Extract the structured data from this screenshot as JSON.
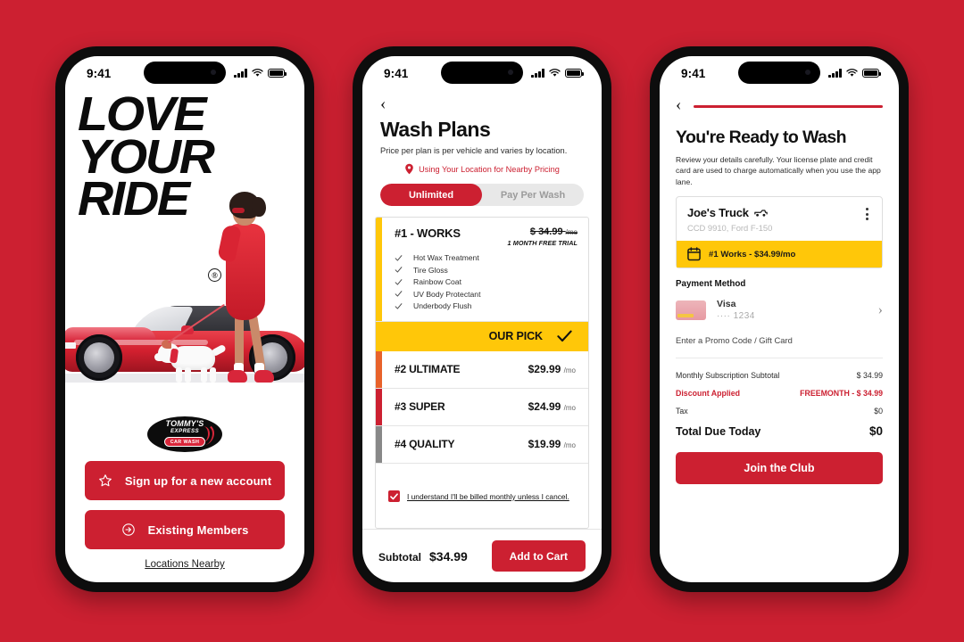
{
  "background_color": "#CC2031",
  "brand": {
    "primary_red": "#CC2031",
    "accent_yellow": "#FFC709",
    "logo_line1": "TOMMY'S",
    "logo_line2": "EXPRESS",
    "logo_pill": "CAR WASH"
  },
  "status_bar": {
    "time": "9:41",
    "signal_icon": "cellular-bars-icon",
    "wifi_icon": "wifi-icon",
    "battery_icon": "battery-icon"
  },
  "phone1": {
    "hero": {
      "line1": "LOVE",
      "line2": "YOUR",
      "line3": "RIDE",
      "registered_mark": "®",
      "image_alt": "red-convertible-with-woman-and-dog"
    },
    "signup_button": "Sign up for a new account",
    "signup_icon": "star-icon",
    "members_button": "Existing Members",
    "members_icon": "login-arrow-icon",
    "locations_link": "Locations Nearby"
  },
  "phone2": {
    "back_icon": "chevron-left-icon",
    "title": "Wash Plans",
    "subtitle": "Price per plan is per vehicle and varies by location.",
    "location_icon": "map-pin-icon",
    "location_note": "Using Your Location for Nearby Pricing",
    "segments": [
      {
        "label": "Unlimited",
        "selected": true
      },
      {
        "label": "Pay Per Wash",
        "selected": false
      }
    ],
    "featured_plan": {
      "name": "#1 - WORKS",
      "price_struck": "$ 34.99",
      "price_unit": "/mo",
      "trial_note": "1 MONTH FREE TRIAL",
      "stripe_color": "#FFC709",
      "features": [
        "Hot Wax Treatment",
        "Tire Gloss",
        "Rainbow Coat",
        "UV Body Protectant",
        "Underbody Flush"
      ],
      "banner_label": "OUR PICK",
      "banner_icon": "check-icon"
    },
    "plans": [
      {
        "name": "#2 ULTIMATE",
        "price": "$29.99",
        "unit": "/mo",
        "stripe_color": "#E8622A"
      },
      {
        "name": "#3 SUPER",
        "price": "$24.99",
        "unit": "/mo",
        "stripe_color": "#CC2031"
      },
      {
        "name": "#4 QUALITY",
        "price": "$19.99",
        "unit": "/mo",
        "stripe_color": "#888888"
      }
    ],
    "acknowledgement": {
      "checked": true,
      "label": "I understand I'll be billed monthly unless I cancel."
    },
    "footer": {
      "subtotal_label": "Subtotal",
      "subtotal_value": "$34.99",
      "cart_button": "Add to Cart"
    }
  },
  "phone3": {
    "back_icon": "chevron-left-icon",
    "progress_percent": 100,
    "title": "You're Ready to Wash",
    "subtitle": "Review your details carefully. Your license plate and credit card are used to charge automatically when you use the app lane.",
    "vehicle": {
      "name": "Joe's Truck",
      "vehicle_icon": "truck-icon",
      "details": "CCD 9910, Ford F-150",
      "menu_icon": "kebab-menu-icon",
      "plan_icon": "calendar-icon",
      "plan_banner": "#1 Works - $34.99/mo"
    },
    "payment": {
      "section_title": "Payment Method",
      "card_icon": "visa-card-icon",
      "brand": "Visa",
      "last4": "···· 1234",
      "chevron_icon": "chevron-right-icon"
    },
    "promo_label": "Enter a Promo Code / Gift Card",
    "totals": [
      {
        "key": "Monthly Subscription Subtotal",
        "value": "$ 34.99",
        "discount": false
      },
      {
        "key": "Discount Applied",
        "value": "FREEMONTH - $ 34.99",
        "discount": true
      },
      {
        "key": "Tax",
        "value": "$0",
        "discount": false
      }
    ],
    "grand_total": {
      "key": "Total Due Today",
      "value": "$0"
    },
    "join_button": "Join the Club"
  }
}
